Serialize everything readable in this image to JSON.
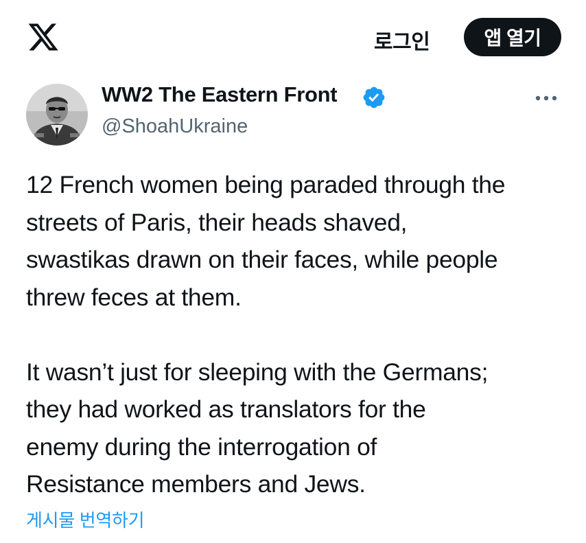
{
  "header": {
    "logo_icon": "x-logo-icon",
    "login_label": "로그인",
    "open_app_label": "앱 열기"
  },
  "tweet": {
    "author": {
      "display_name": "WW2 The Eastern Front",
      "handle": "@ShoahUkraine",
      "verified": true,
      "verified_icon": "verified-badge-icon",
      "avatar_icon": "profile-avatar"
    },
    "more_icon": "more-options-icon",
    "text_lines": [
      "12 French women being paraded through the",
      "streets of Paris, their heads shaved,",
      "swastikas drawn on their faces, while people",
      "threw feces at them.",
      "It wasn’t just for sleeping with the Germans;",
      "they had worked as translators for the",
      "enemy during the interrogation of",
      "Resistance members and Jews."
    ],
    "translate_label": "게시물 번역하기"
  },
  "colors": {
    "text": "#0f1419",
    "secondary": "#536471",
    "accent": "#1d9bf0",
    "button_bg": "#0f1419",
    "button_text": "#ffffff"
  }
}
